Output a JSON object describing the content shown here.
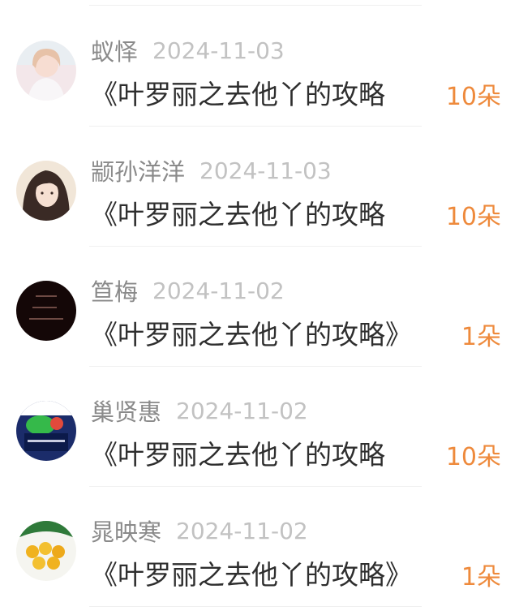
{
  "gifts": [
    {
      "name": "蚁怿",
      "date": "2024-11-03",
      "book": "《叶罗丽之去他丫的攻略",
      "amount": "10朵"
    },
    {
      "name": "颛孙洋洋",
      "date": "2024-11-03",
      "book": "《叶罗丽之去他丫的攻略",
      "amount": "10朵"
    },
    {
      "name": "笪梅",
      "date": "2024-11-02",
      "book": "《叶罗丽之去他丫的攻略》",
      "amount": "1朵"
    },
    {
      "name": "巢贤惠",
      "date": "2024-11-02",
      "book": "《叶罗丽之去他丫的攻略",
      "amount": "10朵"
    },
    {
      "name": "晁映寒",
      "date": "2024-11-02",
      "book": "《叶罗丽之去他丫的攻略》",
      "amount": "1朵"
    }
  ],
  "colors": {
    "amount": "#ee8a3c",
    "name": "#8a8a8a",
    "date": "#c2c2c2",
    "title": "#2e2e2e"
  }
}
